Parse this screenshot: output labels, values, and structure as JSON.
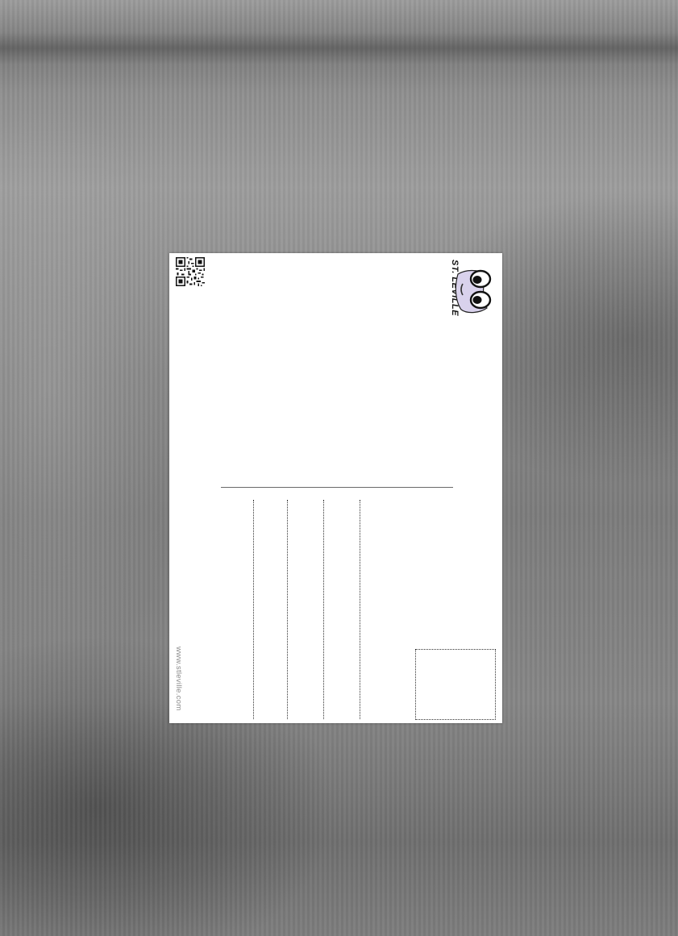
{
  "postcard": {
    "brand_name": "ST. LEVILLE",
    "website": "www.stleville.com",
    "address_lines": 4,
    "qr_icon": "qr-code-icon",
    "mascot_icon": "cartoon-eyes-mascot-icon",
    "colors": {
      "card": "#ffffff",
      "mascot_face": "#d9d2ec",
      "ink": "#111111",
      "website_text": "#8a8a8a"
    }
  }
}
